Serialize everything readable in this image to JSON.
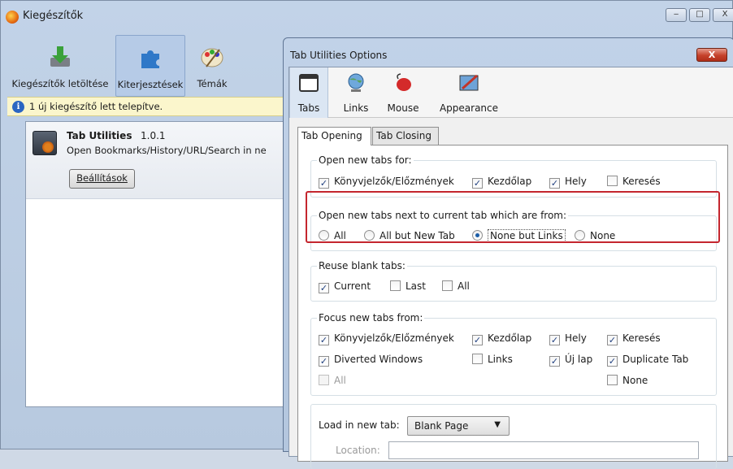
{
  "bg_window": {
    "title": "Kiegészítők",
    "controls": {
      "minimize": "‒",
      "maximize": "□",
      "close": "X"
    },
    "toolbar": [
      {
        "label": "Kiegészítők letöltése"
      },
      {
        "label": "Kiterjesztések"
      },
      {
        "label": "Témák"
      }
    ],
    "notice": "1 új kiegészítő lett telepítve.",
    "extension": {
      "name": "Tab Utilities",
      "version": "1.0.1",
      "description": "Open Bookmarks/History/URL/Search in ne",
      "settings_button": "Beállítások"
    }
  },
  "dialog": {
    "title": "Tab Utilities Options",
    "close_label": "X",
    "tabs": [
      {
        "label": "Tabs",
        "icon": "window-icon"
      },
      {
        "label": "Links",
        "icon": "globe-icon"
      },
      {
        "label": "Mouse",
        "icon": "mouse-icon"
      },
      {
        "label": "Appearance",
        "icon": "paint-icon"
      }
    ],
    "subtabs": [
      "Tab Opening",
      "Tab Closing"
    ],
    "groups": {
      "open_for": {
        "label": "Open new tabs for:",
        "options": [
          {
            "label": "Könyvjelzők/Előzmények",
            "checked": true
          },
          {
            "label": "Kezdőlap",
            "checked": true
          },
          {
            "label": "Hely",
            "checked": true
          },
          {
            "label": "Keresés",
            "checked": false
          }
        ]
      },
      "next_to_current": {
        "label": "Open new tabs next to current tab which are from:",
        "options": [
          {
            "label": "All",
            "selected": false
          },
          {
            "label": "All but New Tab",
            "selected": false
          },
          {
            "label": "None but Links",
            "selected": true
          },
          {
            "label": "None",
            "selected": false
          }
        ]
      },
      "reuse_blank": {
        "label": "Reuse blank tabs:",
        "options": [
          {
            "label": "Current",
            "checked": true
          },
          {
            "label": "Last",
            "checked": false
          },
          {
            "label": "All",
            "checked": false
          }
        ]
      },
      "focus_from": {
        "label": "Focus new tabs from:",
        "options": [
          {
            "label": "Könyvjelzők/Előzmények",
            "checked": true
          },
          {
            "label": "Kezdőlap",
            "checked": true
          },
          {
            "label": "Hely",
            "checked": true
          },
          {
            "label": "Keresés",
            "checked": true
          },
          {
            "label": "Diverted Windows",
            "checked": true
          },
          {
            "label": "Links",
            "checked": false
          },
          {
            "label": "Új lap",
            "checked": true
          },
          {
            "label": "Duplicate Tab",
            "checked": true
          },
          {
            "label": "All",
            "checked": false,
            "disabled": true
          },
          {
            "label": "None",
            "checked": false
          }
        ]
      },
      "load_in_new_tab": {
        "label": "Load in new tab:",
        "selected": "Blank Page",
        "location_label": "Location:",
        "location_value": ""
      }
    }
  },
  "colors": {
    "highlight": "#c4262e",
    "title_bar": "#c1d2e8",
    "close_button": "#c5412a"
  }
}
